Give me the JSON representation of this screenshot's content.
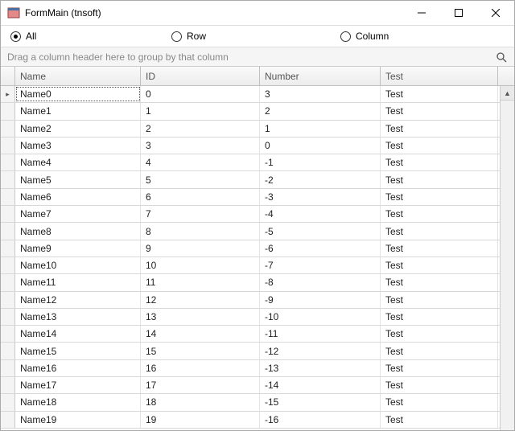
{
  "window": {
    "title": "FormMain (tnsoft)"
  },
  "radios": {
    "all": "All",
    "row": "Row",
    "column": "Column",
    "selected": "all"
  },
  "group_panel": {
    "hint": "Drag a column header here to group by that column"
  },
  "grid": {
    "columns": {
      "name": "Name",
      "id": "ID",
      "number": "Number",
      "test": "Test"
    },
    "focused_row": 0,
    "rows": [
      {
        "name": "Name0",
        "id": "0",
        "number": "3",
        "test": "Test"
      },
      {
        "name": "Name1",
        "id": "1",
        "number": "2",
        "test": "Test"
      },
      {
        "name": "Name2",
        "id": "2",
        "number": "1",
        "test": "Test"
      },
      {
        "name": "Name3",
        "id": "3",
        "number": "0",
        "test": "Test"
      },
      {
        "name": "Name4",
        "id": "4",
        "number": "-1",
        "test": "Test"
      },
      {
        "name": "Name5",
        "id": "5",
        "number": "-2",
        "test": "Test"
      },
      {
        "name": "Name6",
        "id": "6",
        "number": "-3",
        "test": "Test"
      },
      {
        "name": "Name7",
        "id": "7",
        "number": "-4",
        "test": "Test"
      },
      {
        "name": "Name8",
        "id": "8",
        "number": "-5",
        "test": "Test"
      },
      {
        "name": "Name9",
        "id": "9",
        "number": "-6",
        "test": "Test"
      },
      {
        "name": "Name10",
        "id": "10",
        "number": "-7",
        "test": "Test"
      },
      {
        "name": "Name11",
        "id": "11",
        "number": "-8",
        "test": "Test"
      },
      {
        "name": "Name12",
        "id": "12",
        "number": "-9",
        "test": "Test"
      },
      {
        "name": "Name13",
        "id": "13",
        "number": "-10",
        "test": "Test"
      },
      {
        "name": "Name14",
        "id": "14",
        "number": "-11",
        "test": "Test"
      },
      {
        "name": "Name15",
        "id": "15",
        "number": "-12",
        "test": "Test"
      },
      {
        "name": "Name16",
        "id": "16",
        "number": "-13",
        "test": "Test"
      },
      {
        "name": "Name17",
        "id": "17",
        "number": "-14",
        "test": "Test"
      },
      {
        "name": "Name18",
        "id": "18",
        "number": "-15",
        "test": "Test"
      },
      {
        "name": "Name19",
        "id": "19",
        "number": "-16",
        "test": "Test"
      }
    ]
  }
}
